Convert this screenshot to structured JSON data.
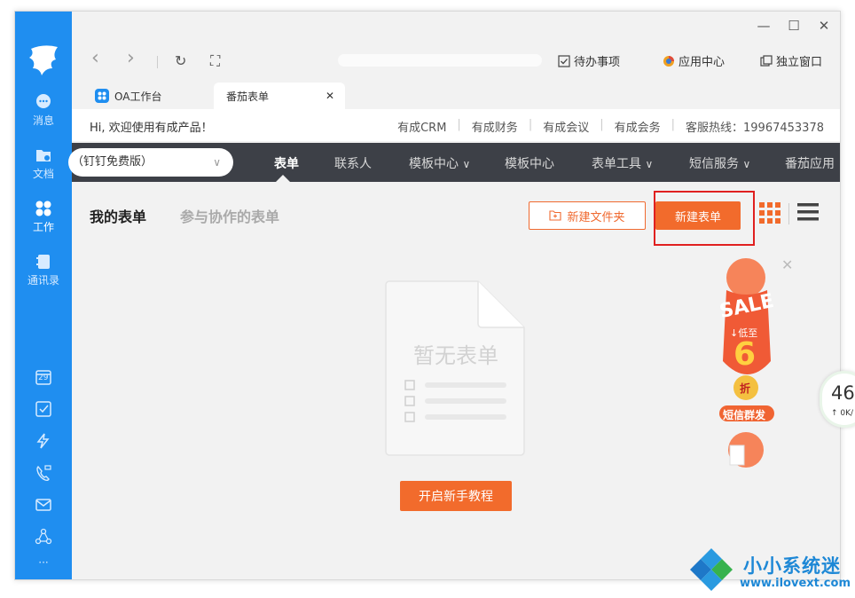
{
  "window": {
    "controls": {
      "minimize": "—",
      "maximize": "☐",
      "close": "✕"
    }
  },
  "rail": {
    "items": [
      {
        "label": "消息",
        "icon": "chat-bubble-icon"
      },
      {
        "label": "文档",
        "icon": "folder-icon"
      },
      {
        "label": "工作",
        "icon": "apps-grid-icon"
      },
      {
        "label": "通讯录",
        "icon": "contacts-book-icon"
      }
    ],
    "bottom_icons": [
      "calendar-29-icon",
      "checkbox-icon",
      "lightning-icon",
      "phone-video-icon",
      "mail-icon",
      "share-nodes-icon",
      "more-dots-icon"
    ],
    "calendar_day": "29",
    "more": "···",
    "accent": "#1f8ef0"
  },
  "toolbar": {
    "back": "‹",
    "forward": "›",
    "refresh": "↻",
    "fullscreen": "⛶",
    "todo_label": "待办事项",
    "app_center_label": "应用中心",
    "standalone_label": "独立窗口"
  },
  "tabs": [
    {
      "label": "OA工作台",
      "active": false
    },
    {
      "label": "番茄表单",
      "active": true,
      "close": "✕"
    }
  ],
  "welcome": {
    "greeting": "Hi, 欢迎使用有成产品！",
    "links": [
      "有成CRM",
      "有成财务",
      "有成会议",
      "有成会务"
    ],
    "hotline": "客服热线：19967453378"
  },
  "nav": {
    "plan": "（钉钉免费版）",
    "items": [
      {
        "label": "表单",
        "active": true
      },
      {
        "label": "联系人"
      },
      {
        "label": "模板中心",
        "dropdown": true
      },
      {
        "label": "模板中心"
      },
      {
        "label": "表单工具",
        "dropdown": true
      },
      {
        "label": "短信服务",
        "dropdown": true
      },
      {
        "label": "番茄应用"
      }
    ],
    "dropdown_glyph": "∨"
  },
  "content": {
    "tab_mine": "我的表单",
    "tab_collab": "参与协作的表单",
    "new_folder": "新建文件夹",
    "new_form": "新建表单",
    "empty_text": "暂无表单",
    "tutorial": "开启新手教程",
    "accent": "#f26b2c"
  },
  "promo": {
    "sale": "SALE",
    "low": "↓低至",
    "discount": "6",
    "unit": "折",
    "sms": "短信群发",
    "close": "✕"
  },
  "speed_widget": {
    "value": "46",
    "sub": "↑ 0K/"
  },
  "watermark": {
    "text": "小小系统迷",
    "url": "www.ilovext.com"
  }
}
